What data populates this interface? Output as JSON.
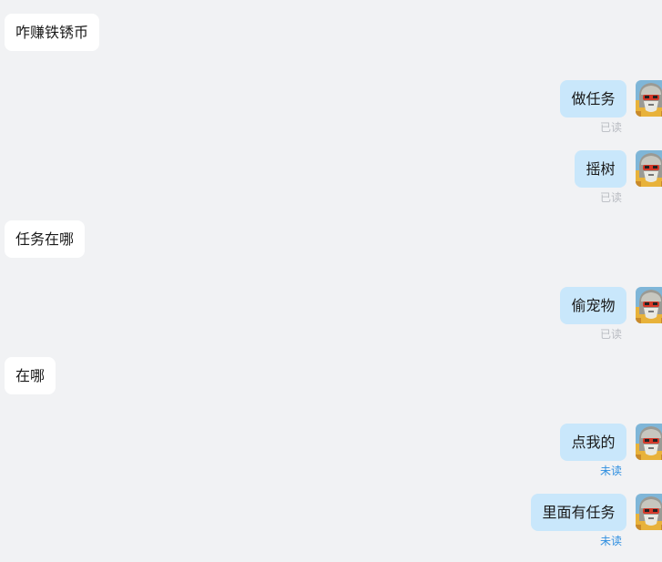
{
  "conversation": {
    "messages": [
      {
        "direction": "incoming",
        "text": "咋赚铁锈币"
      },
      {
        "direction": "outgoing",
        "text": "做任务",
        "status": "已读"
      },
      {
        "direction": "outgoing",
        "text": "摇树",
        "status": "已读"
      },
      {
        "direction": "incoming",
        "text": "任务在哪"
      },
      {
        "direction": "outgoing",
        "text": "偷宠物",
        "status": "已读"
      },
      {
        "direction": "incoming",
        "text": "在哪"
      },
      {
        "direction": "outgoing",
        "text": "点我的",
        "status": "未读"
      },
      {
        "direction": "outgoing",
        "text": "里面有任务",
        "status": "未读"
      }
    ]
  },
  "colors": {
    "background": "#f1f2f4",
    "incoming_bubble": "#ffffff",
    "outgoing_bubble": "#c9e7fb",
    "read_status": "#b9bcc2",
    "unread_status": "#2f8fe0"
  },
  "icons": {
    "avatar": "user-avatar-helmet-icon"
  }
}
